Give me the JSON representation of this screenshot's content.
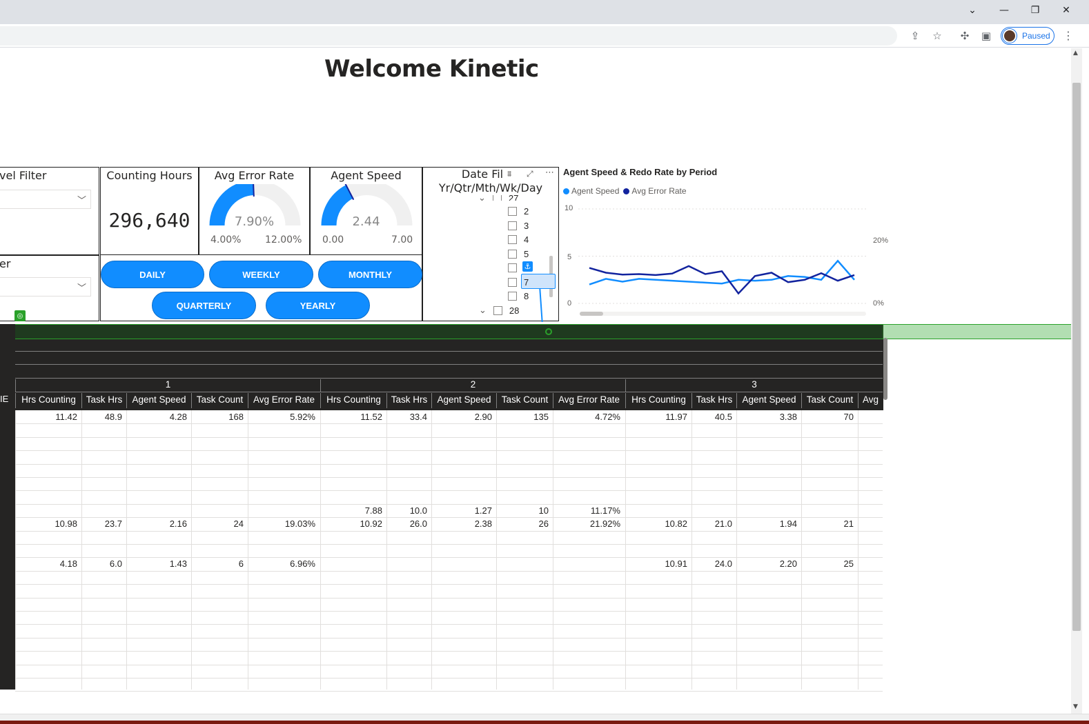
{
  "browser": {
    "profile_label": "Paused"
  },
  "report": {
    "title": "Welcome Kinetic"
  },
  "filters": {
    "level_filter_title": "vel Filter",
    "second_filter_title": "er"
  },
  "kpis": {
    "counting_hours_title": "Counting Hours",
    "counting_hours_value": "296,640",
    "error_rate_title": "Avg Error Rate",
    "error_rate_value": "7.90%",
    "error_rate_min": "4.00%",
    "error_rate_max": "12.00%",
    "error_rate_fraction": 0.4875,
    "agent_speed_title": "Agent Speed",
    "agent_speed_value": "2.44",
    "agent_speed_min": "0.00",
    "agent_speed_max": "7.00",
    "agent_speed_fraction": 0.349
  },
  "period_buttons": {
    "daily": "DAILY",
    "weekly": "WEEKLY",
    "monthly": "MONTHLY",
    "quarterly": "QUARTERLY",
    "yearly": "YEARLY"
  },
  "date_slicer": {
    "title_line1": "Date Fil",
    "title_line2": "Yr/Qtr/Mth/Wk/Day",
    "partial_item": "27",
    "items": [
      "2",
      "3",
      "4",
      "5",
      "6",
      "7",
      "8"
    ],
    "next_group": "28",
    "hovered_item": "7"
  },
  "chart": {
    "title": "Agent Speed & Redo Rate by Period",
    "legend": [
      "Agent Speed",
      "Avg Error Rate"
    ],
    "colors": {
      "agent_speed": "#118dff",
      "avg_error_rate": "#12239e"
    },
    "y_left_ticks": [
      "10",
      "5",
      "0"
    ],
    "y_right_ticks": [
      "20%",
      "0%"
    ]
  },
  "chart_data": {
    "type": "line",
    "title": "Agent Speed & Redo Rate by Period",
    "series": [
      {
        "name": "Agent Speed",
        "axis": "left",
        "values": [
          2.0,
          2.6,
          2.3,
          2.6,
          2.5,
          2.4,
          2.3,
          2.2,
          2.1,
          2.5,
          2.4,
          2.5,
          2.9,
          2.8,
          2.5,
          4.5,
          2.5
        ]
      },
      {
        "name": "Avg Error Rate",
        "axis": "right",
        "values": [
          7.5,
          6.5,
          6.1,
          6.2,
          6.0,
          6.3,
          7.9,
          6.2,
          6.8,
          2.1,
          5.8,
          6.5,
          4.5,
          5.0,
          6.4,
          4.8,
          6.0
        ]
      }
    ],
    "ylim_left": [
      0,
      10
    ],
    "ylim_right": [
      0,
      20
    ],
    "y_right_unit": "%"
  },
  "matrix": {
    "group_labels": [
      "1",
      "2",
      "3"
    ],
    "columns": [
      "Hrs Counting",
      "Task Hrs",
      "Agent Speed",
      "Task Count",
      "Avg Error Rate"
    ],
    "partial_col": "Avg",
    "left_header": "IE",
    "rows": [
      [
        "11.42",
        "48.9",
        "4.28",
        "168",
        "5.92%",
        "11.52",
        "33.4",
        "2.90",
        "135",
        "4.72%",
        "11.97",
        "40.5",
        "3.38",
        "70"
      ],
      [
        "",
        "",
        "",
        "",
        "",
        "",
        "",
        "",
        "",
        "",
        "",
        "",
        "",
        ""
      ],
      [
        "",
        "",
        "",
        "",
        "",
        "",
        "",
        "",
        "",
        "",
        "",
        "",
        "",
        ""
      ],
      [
        "",
        "",
        "",
        "",
        "",
        "",
        "",
        "",
        "",
        "",
        "",
        "",
        "",
        ""
      ],
      [
        "",
        "",
        "",
        "",
        "",
        "",
        "",
        "",
        "",
        "",
        "",
        "",
        "",
        ""
      ],
      [
        "",
        "",
        "",
        "",
        "",
        "",
        "",
        "",
        "",
        "",
        "",
        "",
        "",
        ""
      ],
      [
        "",
        "",
        "",
        "",
        "",
        "",
        "",
        "",
        "",
        "",
        "",
        "",
        "",
        ""
      ],
      [
        "",
        "",
        "",
        "",
        "",
        "7.88",
        "10.0",
        "1.27",
        "10",
        "11.17%",
        "",
        "",
        "",
        ""
      ],
      [
        "10.98",
        "23.7",
        "2.16",
        "24",
        "19.03%",
        "10.92",
        "26.0",
        "2.38",
        "26",
        "21.92%",
        "10.82",
        "21.0",
        "1.94",
        "21"
      ],
      [
        "",
        "",
        "",
        "",
        "",
        "",
        "",
        "",
        "",
        "",
        "",
        "",
        "",
        ""
      ],
      [
        "",
        "",
        "",
        "",
        "",
        "",
        "",
        "",
        "",
        "",
        "",
        "",
        "",
        ""
      ],
      [
        "4.18",
        "6.0",
        "1.43",
        "6",
        "6.96%",
        "",
        "",
        "",
        "",
        "",
        "10.91",
        "24.0",
        "2.20",
        "25"
      ]
    ]
  }
}
